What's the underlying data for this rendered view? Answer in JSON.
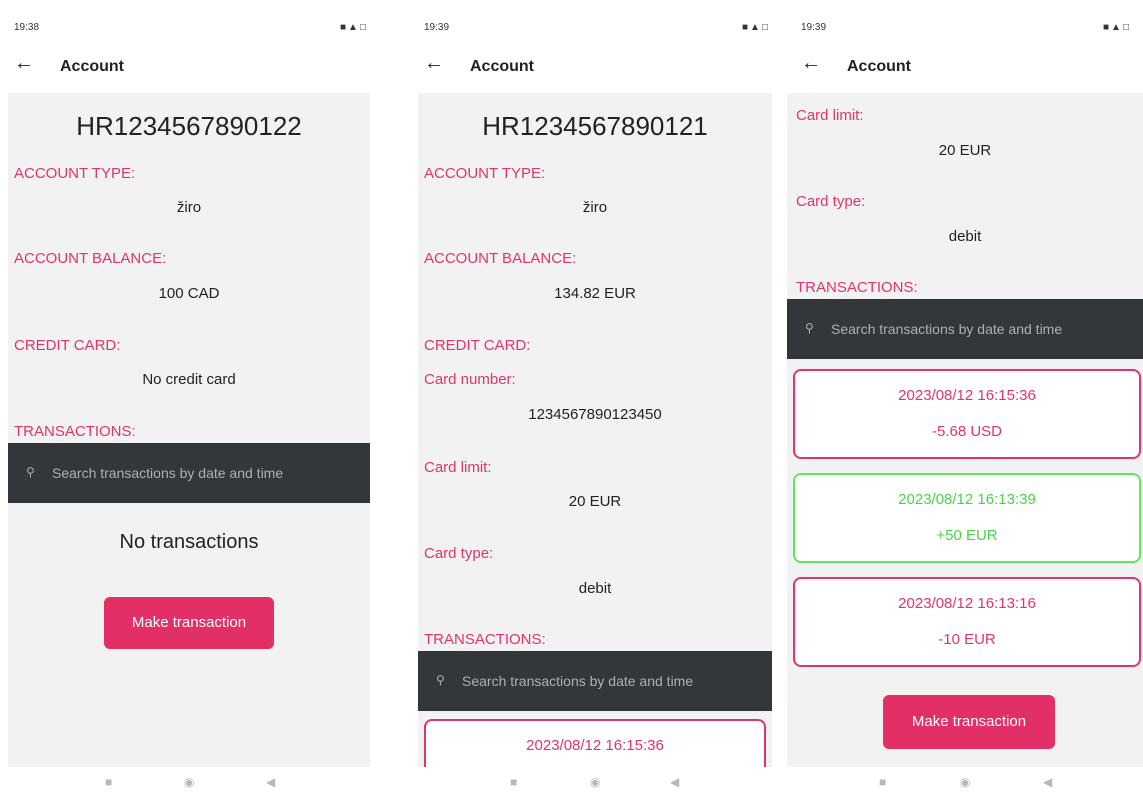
{
  "colors": {
    "accent": "#e0356a",
    "button": "#e22f66",
    "positive": "#48d448",
    "search_bg": "#33373b"
  },
  "screens": [
    {
      "status": {
        "time": "19:38",
        "right_icons": "■▲□"
      },
      "appbar": {
        "back_icon": "←",
        "title": "Account"
      },
      "iban": "HR1234567890122",
      "account_type_label": "ACCOUNT TYPE:",
      "account_type": "žiro",
      "balance_label": "ACCOUNT BALANCE:",
      "balance": "100 CAD",
      "credit_card_label": "CREDIT CARD:",
      "credit_card_value": "No credit card",
      "transactions_label": "TRANSACTIONS:",
      "search_placeholder": "Search transactions by date and time",
      "empty_text": "No transactions",
      "make_button": "Make transaction"
    },
    {
      "status": {
        "time": "19:39",
        "right_icons": "■▲□"
      },
      "appbar": {
        "back_icon": "←",
        "title": "Account"
      },
      "iban": "HR1234567890121",
      "account_type_label": "ACCOUNT TYPE:",
      "account_type": "žiro",
      "balance_label": "ACCOUNT BALANCE:",
      "balance": "134.82 EUR",
      "credit_card_label": "CREDIT CARD:",
      "card_number_label": "Card number:",
      "card_number": "1234567890123450",
      "card_limit_label": "Card limit:",
      "card_limit": "20 EUR",
      "card_type_label": "Card type:",
      "card_type": "debit",
      "transactions_label": "TRANSACTIONS:",
      "search_placeholder": "Search transactions by date and time",
      "transactions": [
        {
          "datetime": "2023/08/12 16:15:36"
        }
      ]
    },
    {
      "status": {
        "time": "19:39",
        "right_icons": "■▲□"
      },
      "appbar": {
        "back_icon": "←",
        "title": "Account"
      },
      "card_limit_label": "Card limit:",
      "card_limit": "20 EUR",
      "card_type_label": "Card type:",
      "card_type": "debit",
      "transactions_label": "TRANSACTIONS:",
      "search_placeholder": "Search transactions by date and time",
      "transactions": [
        {
          "datetime": "2023/08/12 16:15:36",
          "amount": "-5.68 USD",
          "type": "negative"
        },
        {
          "datetime": "2023/08/12 16:13:39",
          "amount": "+50 EUR",
          "type": "positive"
        },
        {
          "datetime": "2023/08/12 16:13:16",
          "amount": "-10 EUR",
          "type": "negative"
        }
      ],
      "make_button": "Make transaction"
    }
  ],
  "nav": {
    "recents_icon": "■",
    "home_icon": "◉",
    "back_icon": "◀"
  }
}
